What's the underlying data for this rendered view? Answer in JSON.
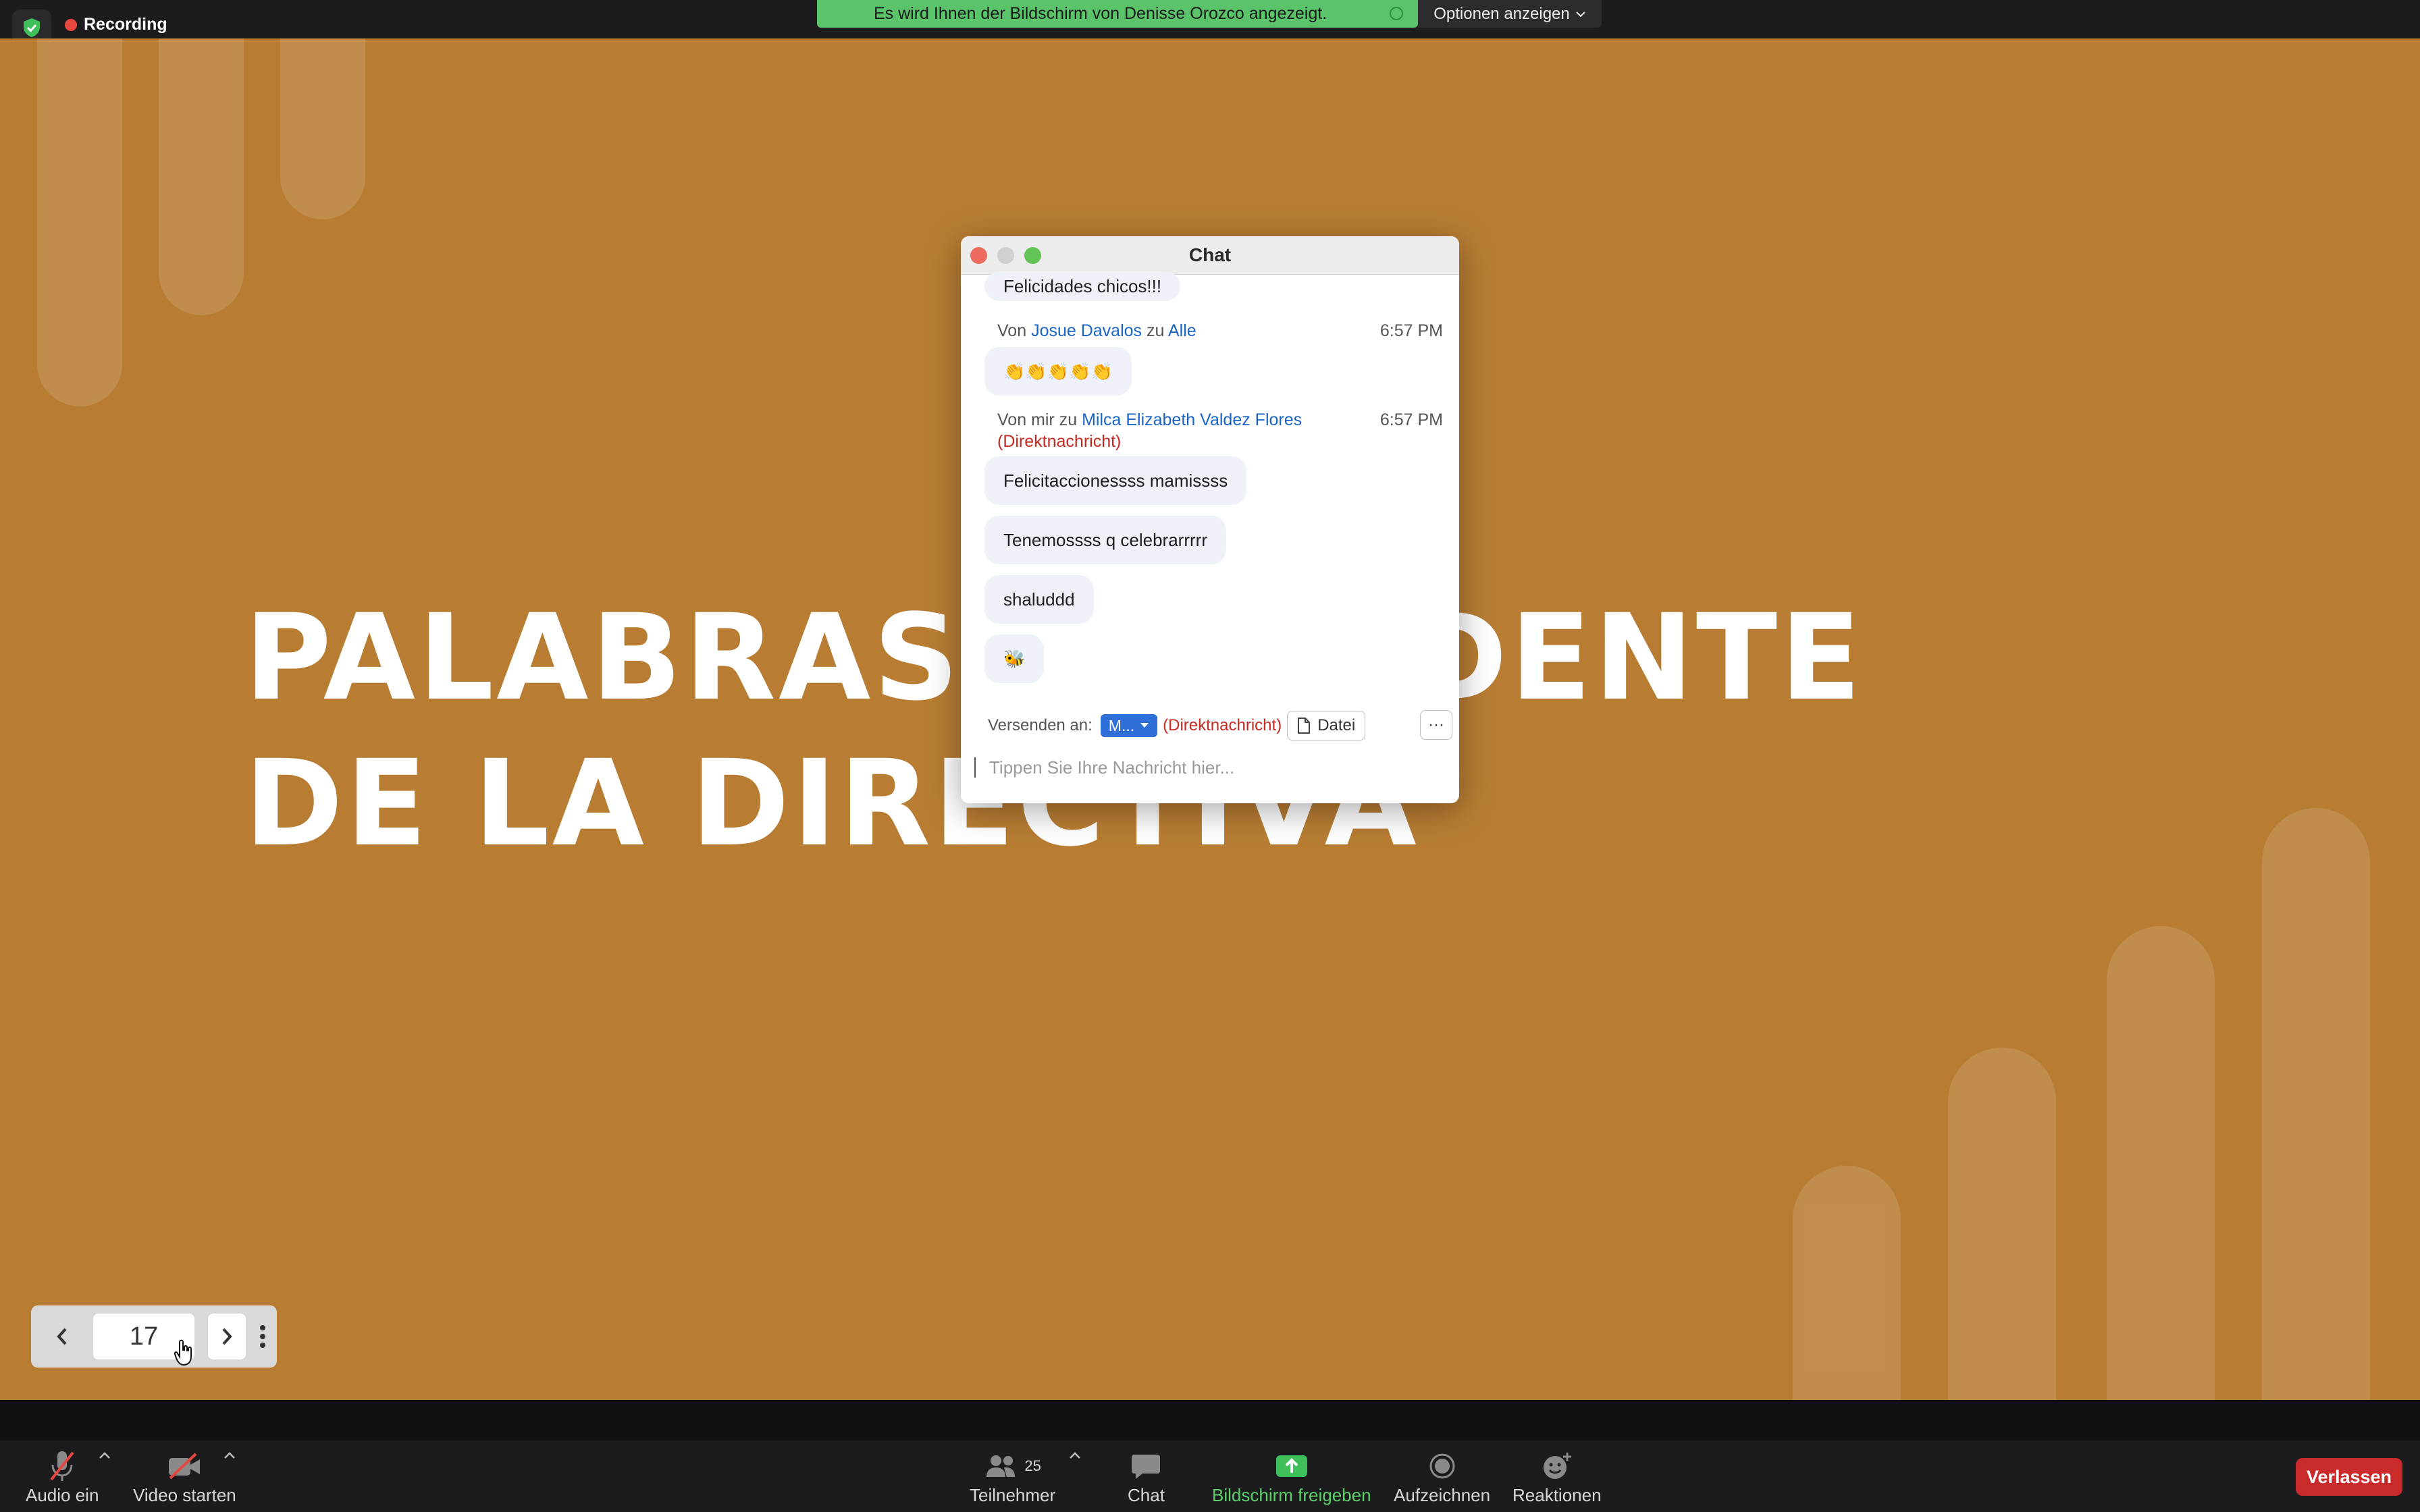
{
  "top": {
    "recording_label": "Recording",
    "share_banner": "Es wird Ihnen der Bildschirm von Denisse Orozco angezeigt.",
    "options_label": "Optionen anzeigen"
  },
  "slide": {
    "title_line1": "PALABRAS PRESIDENTE",
    "title_line2": "DE LA DIRECTIVA"
  },
  "navigator": {
    "page": "17"
  },
  "chat": {
    "title": "Chat",
    "msg0": "Felicidades chicos!!!",
    "meta1": {
      "prefix": "Von",
      "sender": "Josue Davalos",
      "conj": "zu",
      "recipient": "Alle",
      "time": "6:57 PM"
    },
    "msg1": "👏👏👏👏👏",
    "meta2": {
      "prefix": "Von mir zu",
      "recipient": "Milca Elizabeth Valdez Flores",
      "dm": "(Direktnachricht)",
      "time": "6:57 PM"
    },
    "msg2": "Felicitaccionessss mamissss",
    "msg3": "Tenemossss q celebrarrrrr",
    "msg4": "shaluddd",
    "msg5": "🐝",
    "send_to_label": "Versenden an:",
    "recipient_short": "M...",
    "dm_tag": "(Direktnachricht)",
    "file_label": "Datei",
    "more_label": "···",
    "input_placeholder": "Tippen Sie Ihre Nachricht hier..."
  },
  "toolbar": {
    "audio": "Audio ein",
    "video": "Video starten",
    "participants": "Teilnehmer",
    "participants_count": "25",
    "chat": "Chat",
    "share": "Bildschirm freigeben",
    "record": "Aufzeichnen",
    "reactions": "Reaktionen",
    "leave": "Verlassen"
  },
  "colors": {
    "slide_bg": "#b87d33",
    "share_green": "#5bc36a",
    "leave_red": "#c92a2a",
    "link_blue": "#1a64c6",
    "dm_red": "#c42a21"
  }
}
